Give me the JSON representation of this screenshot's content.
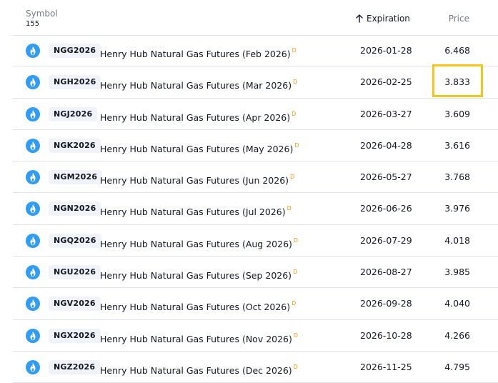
{
  "header": {
    "symbol_label": "Symbol",
    "count": "155",
    "expiration_label": "Expiration",
    "price_label": "Price",
    "sort_icon": "arrow-up-icon"
  },
  "colors": {
    "logo_bg": "#2f9cf5",
    "delay_marker": "#ff9800",
    "highlight": "#f5c518",
    "ticker_bg": "#f0f3fa"
  },
  "rows": [
    {
      "ticker": "NGG2026",
      "name": "Henry Hub Natural Gas Futures (Feb 2026)",
      "marker": "D",
      "expiration": "2026-01-28",
      "price": "6.468"
    },
    {
      "ticker": "NGH2026",
      "name": "Henry Hub Natural Gas Futures (Mar 2026)",
      "marker": "D",
      "expiration": "2026-02-25",
      "price": "3.833"
    },
    {
      "ticker": "NGJ2026",
      "name": "Henry Hub Natural Gas Futures (Apr 2026)",
      "marker": "D",
      "expiration": "2026-03-27",
      "price": "3.609"
    },
    {
      "ticker": "NGK2026",
      "name": "Henry Hub Natural Gas Futures (May 2026)",
      "marker": "D",
      "expiration": "2026-04-28",
      "price": "3.616"
    },
    {
      "ticker": "NGM2026",
      "name": "Henry Hub Natural Gas Futures (Jun 2026)",
      "marker": "D",
      "expiration": "2026-05-27",
      "price": "3.768"
    },
    {
      "ticker": "NGN2026",
      "name": "Henry Hub Natural Gas Futures (Jul 2026)",
      "marker": "D",
      "expiration": "2026-06-26",
      "price": "3.976"
    },
    {
      "ticker": "NGQ2026",
      "name": "Henry Hub Natural Gas Futures (Aug 2026)",
      "marker": "D",
      "expiration": "2026-07-29",
      "price": "4.018"
    },
    {
      "ticker": "NGU2026",
      "name": "Henry Hub Natural Gas Futures (Sep 2026)",
      "marker": "D",
      "expiration": "2026-08-27",
      "price": "3.985"
    },
    {
      "ticker": "NGV2026",
      "name": "Henry Hub Natural Gas Futures (Oct 2026)",
      "marker": "D",
      "expiration": "2026-09-28",
      "price": "4.040"
    },
    {
      "ticker": "NGX2026",
      "name": "Henry Hub Natural Gas Futures (Nov 2026)",
      "marker": "D",
      "expiration": "2026-10-28",
      "price": "4.266"
    },
    {
      "ticker": "NGZ2026",
      "name": "Henry Hub Natural Gas Futures (Dec 2026)",
      "marker": "D",
      "expiration": "2026-11-25",
      "price": "4.795"
    }
  ]
}
